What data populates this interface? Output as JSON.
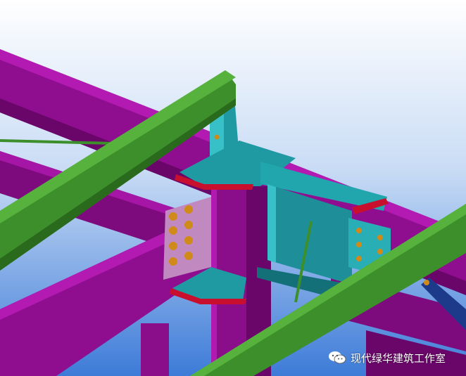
{
  "scene": {
    "title": "",
    "colors": {
      "sky_top": "#ffffff",
      "sky_bottom": "#3d7bd8",
      "beam_magenta": "#8f0e8f",
      "beam_magenta_light": "#b21ab2",
      "beam_magenta_dark": "#6a066a",
      "beam_green": "#3c8f2a",
      "beam_green_light": "#56b23c",
      "beam_green_dark": "#2a6a1d",
      "plate_teal": "#1f9aa3",
      "plate_teal_light": "#38c0c8",
      "plate_teal_dark": "#137078",
      "weld_red": "#c8102e",
      "bolt_orange": "#d08a1a",
      "plate_lavender": "#c08ac0",
      "brace_blue": "#1d3a8a"
    }
  },
  "watermark": {
    "icon": "wechat-icon",
    "text": "现代绿华建筑工作室"
  }
}
